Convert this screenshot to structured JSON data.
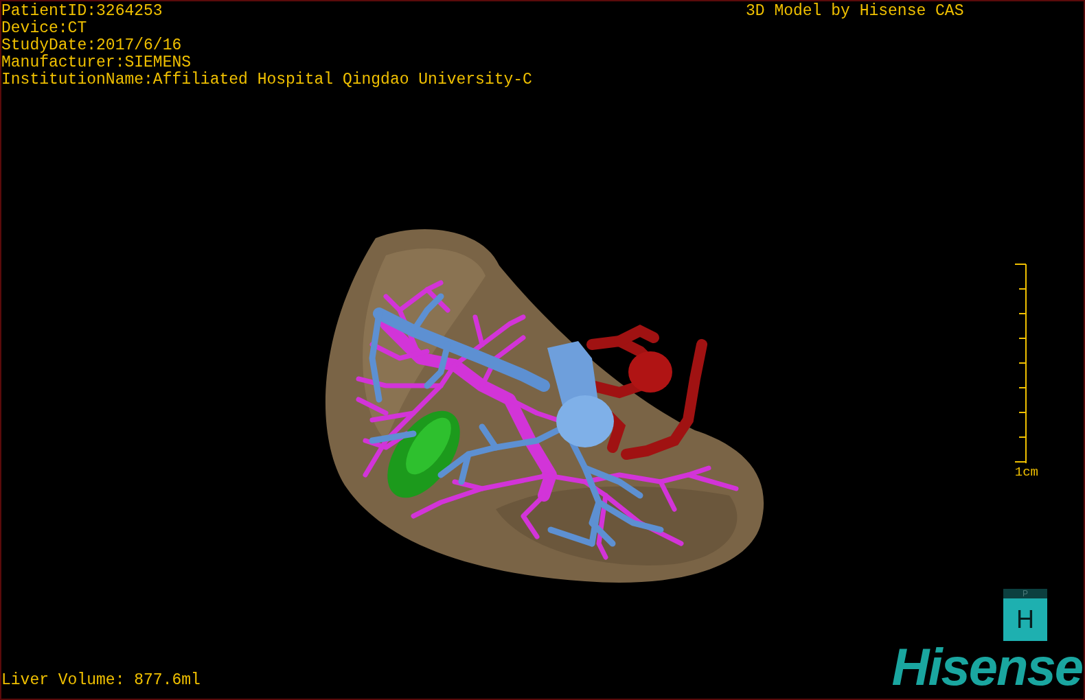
{
  "study_info": [
    "PatientID:3264253",
    "Device:CT",
    "StudyDate:2017/6/16",
    "Manufacturer:SIEMENS",
    "InstitutionName:Affiliated Hospital Qingdao University-C"
  ],
  "model_title": "3D Model by Hisense CAS",
  "scale_bar": {
    "label": "1cm"
  },
  "liver_volume": "Liver Volume: 877.6ml",
  "orientation_cube": {
    "top": "P",
    "front": "H"
  },
  "logo": "Hisense"
}
